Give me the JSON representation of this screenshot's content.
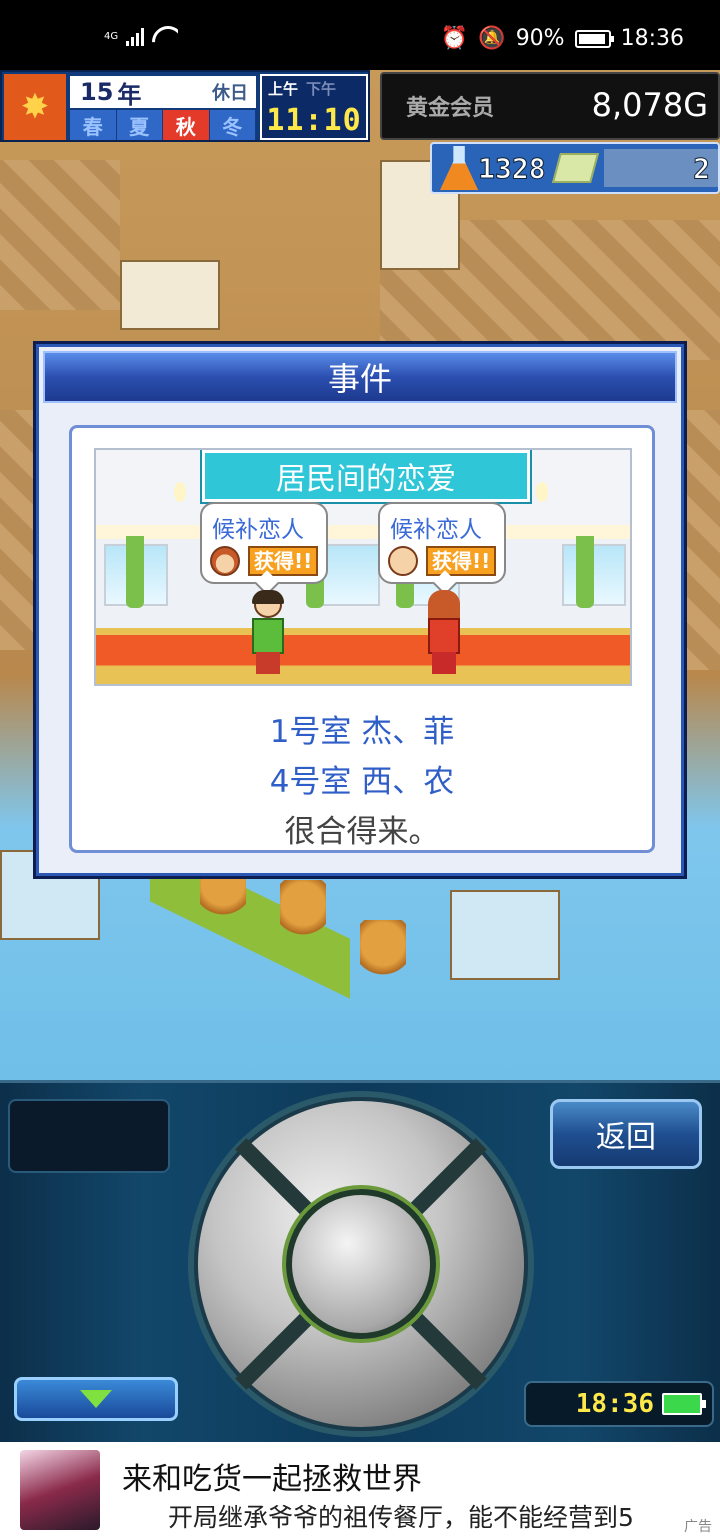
{
  "status_bar": {
    "network": "4G",
    "battery": "90%",
    "time": "18:36"
  },
  "hud": {
    "year": "15",
    "year_unit": "年",
    "holiday": "休日",
    "seasons": [
      "春",
      "夏",
      "秋",
      "冬"
    ],
    "active_season": "秋",
    "am": "上午",
    "pm": "下午",
    "clock": "11:10",
    "membership": "黄金会员",
    "gold": "8,078G",
    "research_points": "1328",
    "tickets": "2"
  },
  "dialog": {
    "title": "事件",
    "scene_title": "居民间的恋爱",
    "bubble_label": "候补恋人",
    "bubble_got": "获得!!",
    "line1": "1号室 杰、菲",
    "line2": "4号室 西、农",
    "line3": "很合得来。"
  },
  "controls": {
    "back_label": "返回",
    "clock": "18:36"
  },
  "ad": {
    "title": "来和吃货一起拯救世界",
    "subtitle": "开局继承爷爷的祖传餐厅，能不能经营到5",
    "tag": "广告"
  }
}
